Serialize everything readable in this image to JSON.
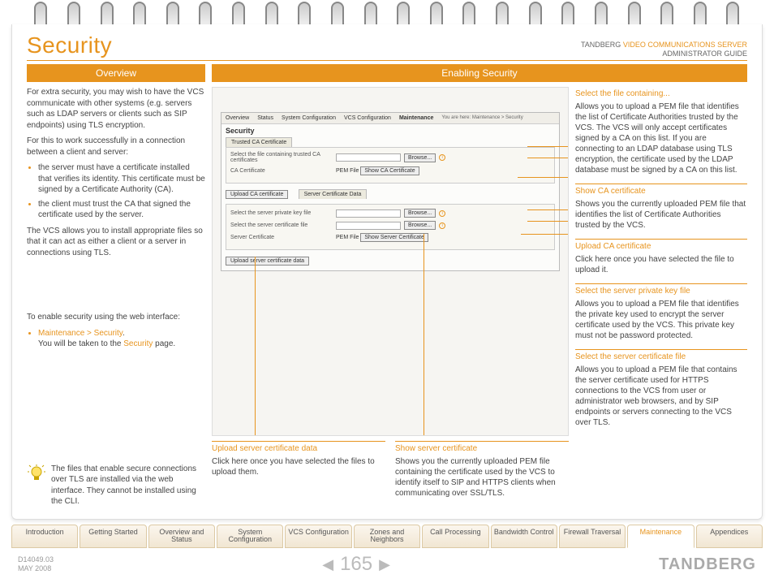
{
  "header": {
    "title": "Security",
    "brand_line1_a": "TANDBERG ",
    "brand_line1_b": "VIDEO COMMUNICATIONS SERVER",
    "brand_line2": "ADMINISTRATOR GUIDE"
  },
  "overview": {
    "banner": "Overview",
    "p1": "For extra security, you may wish to have the VCS communicate with other systems (e.g. servers such as LDAP servers or clients such as SIP endpoints) using TLS encryption.",
    "p2": "For this to work successfully in a connection between a client and server:",
    "li1": "the server must have a certificate installed that verifies its identity. This certificate must be signed by a Certificate Authority (CA).",
    "li2": "the client must trust the CA that signed the certificate used by the server.",
    "p3": "The VCS allows you to install appropriate files so that it can act as either a client or a server in connections using TLS.",
    "p4": "To enable security using the web interface:",
    "nav_link": "Maintenance > Security",
    "nav_suffix": ".",
    "nav_line2a": "You will be taken to the ",
    "nav_line2_link": "Security",
    "nav_line2b": " page.",
    "tip": "The files that enable secure connections over TLS are installed via the web interface. They cannot be installed using the CLI."
  },
  "enabling": {
    "banner": "Enabling Security"
  },
  "mini": {
    "tabs": [
      "Overview",
      "Status",
      "System Configuration",
      "VCS Configuration",
      "Maintenance"
    ],
    "crumb": "You are here: Maintenance > Security",
    "title": "Security",
    "sec1_tab": "Trusted CA Certificate",
    "sec1_row1_lbl": "Select the file containing trusted CA certificates",
    "browse": "Browse...",
    "sec1_row2_lbl": "CA Certificate",
    "pem": "PEM File",
    "show_ca": "Show CA Certificate",
    "upload_ca_btn": "Upload CA certificate",
    "sec2_tab": "Server Certificate Data",
    "sec2_row1_lbl": "Select the server private key file",
    "sec2_row2_lbl": "Select the server certificate file",
    "sec2_row3_lbl": "Server Certificate",
    "show_srv": "Show Server Certificate",
    "upload_srv_btn": "Upload server certificate data"
  },
  "annots": {
    "a1_h": "Select the file containing...",
    "a1_b": "Allows you to upload a PEM file that identifies the list of Certificate Authorities trusted by the VCS. The VCS will only accept certificates signed by a CA on this list. If you are connecting to an LDAP database using TLS encryption, the certificate used by the LDAP database must be signed by a CA on this list.",
    "a2_h": "Show CA certificate",
    "a2_b": "Shows you the currently uploaded PEM file that identifies the list of Certificate Authorities trusted by the VCS.",
    "a3_h": "Upload CA certificate",
    "a3_b": "Click here once you have selected the file to upload it.",
    "a4_h": "Select the server private key file",
    "a4_b": "Allows you to upload a PEM file that identifies the private key used to encrypt the server certificate used by the VCS. This private key must not be password protected.",
    "a5_h": "Select the server certificate file",
    "a5_b": "Allows you to upload a PEM file that contains the server certificate used for HTTPS connections to the VCS from user or administrator web browsers, and by SIP endpoints or servers connecting to the VCS over TLS.",
    "b1_h": "Upload server certificate data",
    "b1_b": "Click here once you have selected the files to upload them.",
    "b2_h": "Show server certificate",
    "b2_b": "Shows you the currently uploaded PEM file containing the certificate used by the VCS to identify itself to SIP and HTTPS clients when communicating over SSL/TLS."
  },
  "navtabs": [
    "Introduction",
    "Getting Started",
    "Overview and Status",
    "System Configuration",
    "VCS Configuration",
    "Zones and Neighbors",
    "Call Processing",
    "Bandwidth Control",
    "Firewall Traversal",
    "Maintenance",
    "Appendices"
  ],
  "footer": {
    "doc": "D14049.03",
    "date": "MAY 2008",
    "page": "165",
    "brand": "TANDBERG"
  }
}
